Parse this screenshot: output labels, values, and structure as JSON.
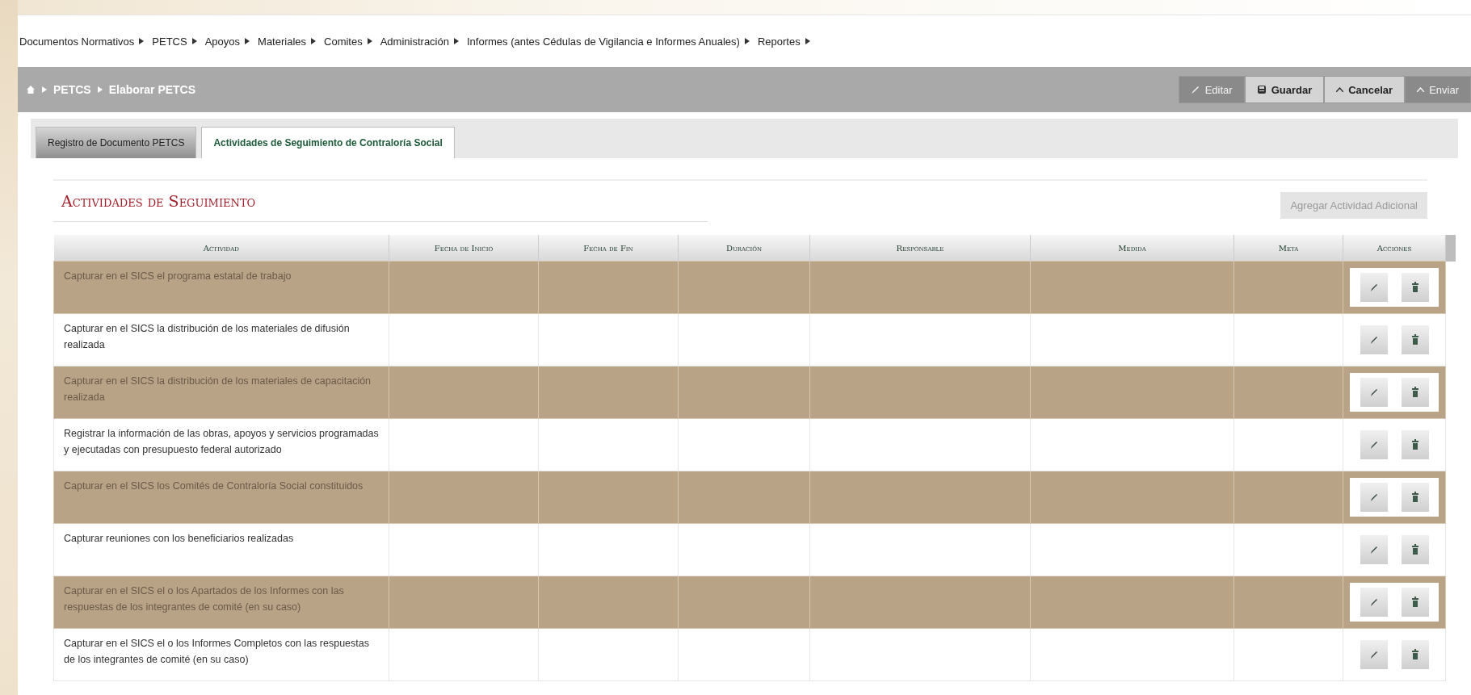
{
  "menu": [
    "Documentos Normativos",
    "PETCS",
    "Apoyos",
    "Materiales",
    "Comites",
    "Administración",
    "Informes (antes Cédulas de Vigilancia e Informes Anuales)",
    "Reportes"
  ],
  "breadcrumb": [
    "PETCS",
    "Elaborar PETCS"
  ],
  "toolbar": [
    {
      "label": "Editar",
      "disabled": true
    },
    {
      "label": "Guardar",
      "disabled": false
    },
    {
      "label": "Cancelar",
      "disabled": false
    },
    {
      "label": "Enviar",
      "disabled": true
    }
  ],
  "tabs": [
    {
      "label": "Registro de Documento PETCS",
      "selected": false
    },
    {
      "label": "Actividades de Seguimiento de Contraloría Social",
      "selected": true
    }
  ],
  "section_title": "Actividades de Seguimiento",
  "add_button": {
    "label": "Agregar Actividad Adicional",
    "disabled": true
  },
  "table": {
    "columns": [
      "Actividad",
      "Fecha de Inicio",
      "Fecha de Fin",
      "Duración",
      "Responsable",
      "Medida",
      "Meta",
      "Acciones"
    ],
    "rows": [
      {
        "actividad": "Capturar en el SICS el programa estatal de trabajo"
      },
      {
        "actividad": "Capturar en el SICS la distribución de los materiales de difusión realizada"
      },
      {
        "actividad": "Capturar en el SICS la distribución de los materiales de capacitación realizada"
      },
      {
        "actividad": "Registrar la información de las obras, apoyos y servicios programadas y ejecutadas con presupuesto federal autorizado"
      },
      {
        "actividad": "Capturar en el SICS los Comités de Contraloría Social constituidos"
      },
      {
        "actividad": "Capturar reuniones con los beneficiarios realizadas"
      },
      {
        "actividad": "Capturar en el SICS el o los Apartados de los Informes con las respuestas de los integrantes de comité (en su caso)"
      },
      {
        "actividad": "Capturar en el SICS el o los Informes Completos con las respuestas de los integrantes de comité (en su caso)"
      }
    ]
  }
}
